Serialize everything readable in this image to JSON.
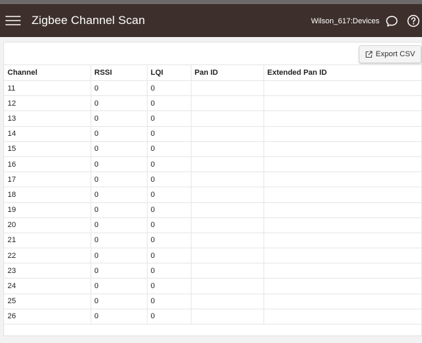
{
  "app": {
    "title": "Zigbee Channel Scan",
    "hub_name": "Wilson_617:Devices",
    "menu_icon": "hamburger-menu-icon",
    "chat_icon": "chat-bubble-icon",
    "help_icon": "help-circle-icon",
    "colors": {
      "appbar": "#3d302c",
      "topstrip": "#6d6a69"
    }
  },
  "toolbar": {
    "export_label": "Export CSV",
    "export_icon": "external-link-icon"
  },
  "table": {
    "columns": [
      "Channel",
      "RSSI",
      "LQI",
      "Pan ID",
      "Extended Pan ID"
    ],
    "rows": [
      [
        "11",
        "0",
        "0",
        "",
        ""
      ],
      [
        "12",
        "0",
        "0",
        "",
        ""
      ],
      [
        "13",
        "0",
        "0",
        "",
        ""
      ],
      [
        "14",
        "0",
        "0",
        "",
        ""
      ],
      [
        "15",
        "0",
        "0",
        "",
        ""
      ],
      [
        "16",
        "0",
        "0",
        "",
        ""
      ],
      [
        "17",
        "0",
        "0",
        "",
        ""
      ],
      [
        "18",
        "0",
        "0",
        "",
        ""
      ],
      [
        "19",
        "0",
        "0",
        "",
        ""
      ],
      [
        "20",
        "0",
        "0",
        "",
        ""
      ],
      [
        "21",
        "0",
        "0",
        "",
        ""
      ],
      [
        "22",
        "0",
        "0",
        "",
        ""
      ],
      [
        "23",
        "0",
        "0",
        "",
        ""
      ],
      [
        "24",
        "0",
        "0",
        "",
        ""
      ],
      [
        "25",
        "0",
        "0",
        "",
        ""
      ],
      [
        "26",
        "0",
        "0",
        "",
        ""
      ]
    ]
  }
}
